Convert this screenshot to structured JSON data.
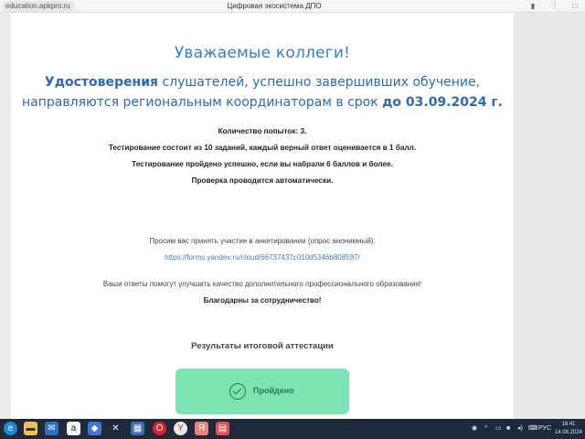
{
  "browser": {
    "url": "education.apkpro.ru",
    "title": "Цифровая экосистема ДПО"
  },
  "page": {
    "heading": "Уважаемые коллеги!",
    "notice_line1_bold": "Удостоверения",
    "notice_line1_rest": " слушателей, успешно завершивших обучение,",
    "notice_line2_start": "направляются региональным координаторам в срок ",
    "notice_line2_bold": "до 03.09.2024 г.",
    "attempts": "Количество попыток: 3.",
    "test_info": "Тестирование состоит из 10 заданий, каждый верный ответ оценивается в 1 балл.",
    "pass_info": "Тестирование пройдено успешно, если вы набрали 6 баллов и более.",
    "auto_check": "Проверка проводится автоматически.",
    "survey_invite": "Просим вас принять участие в анкетировании (опрос анонимный):",
    "survey_link": "https://forms.yandex.ru/cloud/66737437c010d5346b808597/",
    "survey_note": "Ваши ответы помогут улучшить качество дополнительного профессионального образования!",
    "thanks": "Благодарны за сотрудничество!",
    "results_title": "Результаты итоговой аттестации",
    "result_status": "Пройдено"
  },
  "taskbar": {
    "lang": "РУС",
    "time": "16:41",
    "date": "14.08.2024"
  },
  "colors": {
    "heading": "#2f7fd8",
    "notice": "#2d69b8",
    "link": "#4a78c2",
    "passed_bg": "#7de3b2",
    "passed_fg": "#2b7a55",
    "taskbar": "#1e2a3a"
  }
}
